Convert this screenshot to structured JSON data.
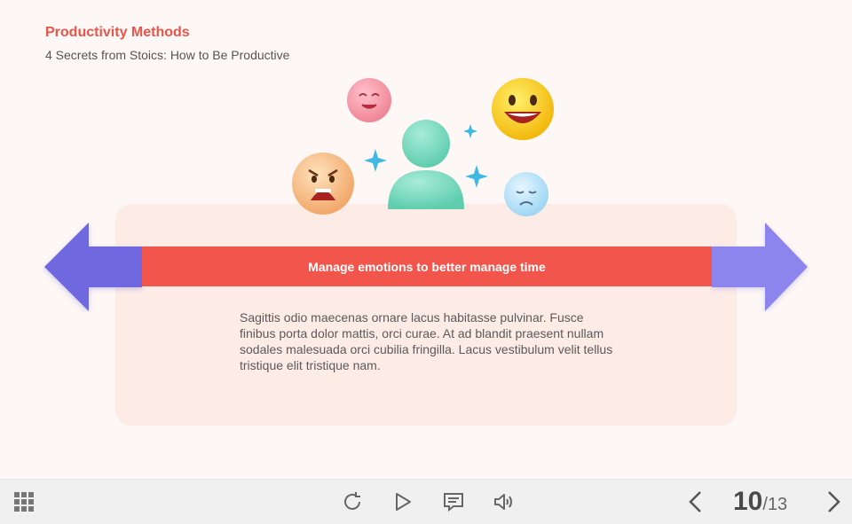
{
  "header": {
    "title": "Productivity Methods",
    "subtitle": "4 Secrets from Stoics: How to Be Productive"
  },
  "content": {
    "banner": "Manage emotions to better manage time",
    "body": "Sagittis odio maecenas ornare lacus habitasse pulvinar. Fusce finibus porta dolor mattis, orci curae. At ad blandit praesent nullam sodales malesuada orci cubilia fringilla. Lacus vestibulum velit tellus tristique elit tristique nam."
  },
  "illustration": {
    "icons": [
      "person-icon",
      "smiling-face-icon",
      "laughing-face-icon",
      "frightened-face-icon",
      "sad-face-icon",
      "sparkle-icon"
    ]
  },
  "colors": {
    "accent": "#e8554b",
    "band": "#f1554c",
    "arrow_left": "#7067df",
    "arrow_right": "#8c85ee",
    "person": "#7fdcc1"
  },
  "player": {
    "page_current": "10",
    "page_separator": "/",
    "page_total": "13",
    "icons": [
      "menu-grid-icon",
      "replay-icon",
      "play-icon",
      "notes-icon",
      "volume-icon",
      "prev-icon",
      "next-icon"
    ]
  }
}
